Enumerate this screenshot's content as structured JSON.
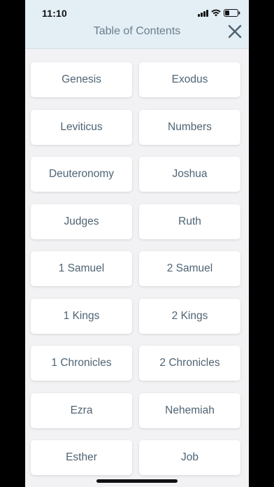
{
  "status_bar": {
    "time": "11:10"
  },
  "header": {
    "title": "Table of Contents",
    "close_icon": "close-icon",
    "background": "#e3eef5",
    "title_color": "#6a7f8f",
    "accent": "#4f6474"
  },
  "books": [
    {
      "label": "Genesis"
    },
    {
      "label": "Exodus"
    },
    {
      "label": "Leviticus"
    },
    {
      "label": "Numbers"
    },
    {
      "label": "Deuteronomy"
    },
    {
      "label": "Joshua"
    },
    {
      "label": "Judges"
    },
    {
      "label": "Ruth"
    },
    {
      "label": "1 Samuel"
    },
    {
      "label": "2 Samuel"
    },
    {
      "label": "1 Kings"
    },
    {
      "label": "2 Kings"
    },
    {
      "label": "1 Chronicles"
    },
    {
      "label": "2 Chronicles"
    },
    {
      "label": "Ezra"
    },
    {
      "label": "Nehemiah"
    },
    {
      "label": "Esther"
    },
    {
      "label": "Job"
    }
  ]
}
